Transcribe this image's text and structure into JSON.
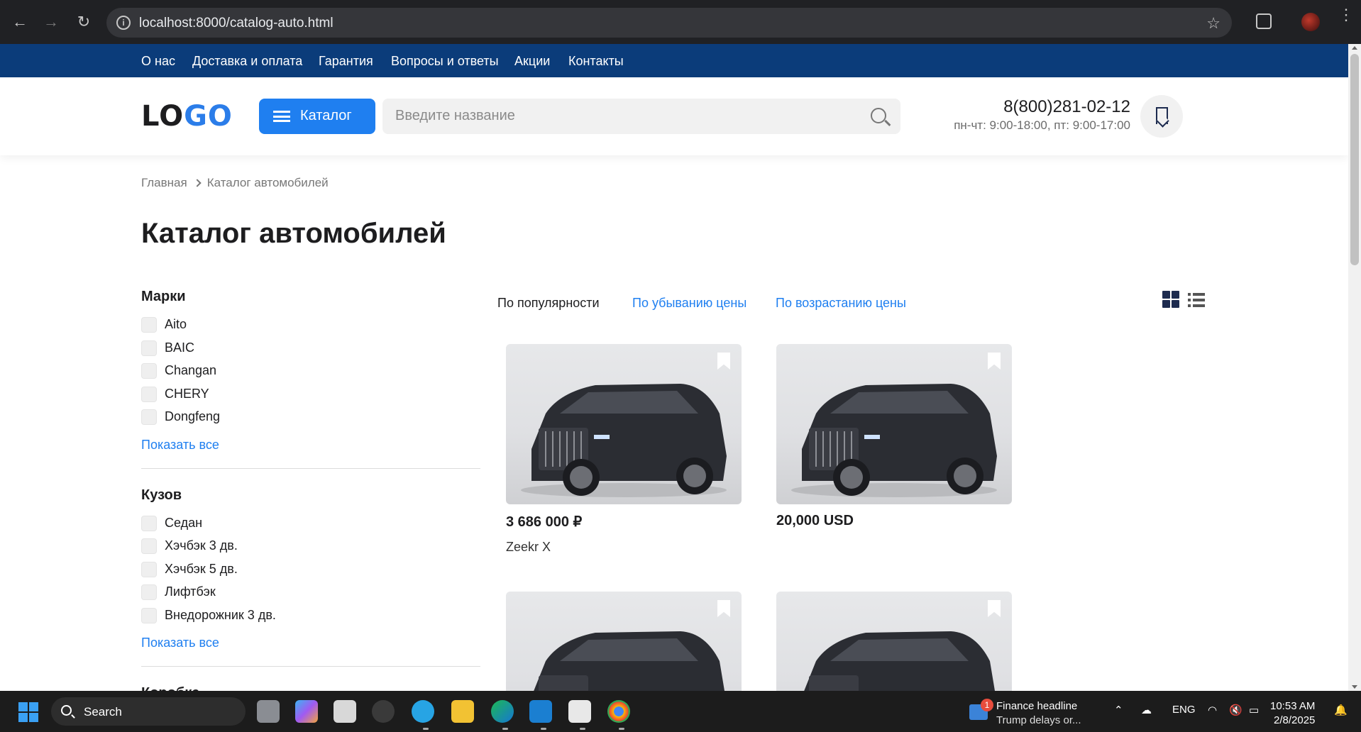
{
  "browser": {
    "url": "localhost:8000/catalog-auto.html"
  },
  "topnav": {
    "items": [
      "О нас",
      "Доставка и оплата",
      "Гарантия",
      "Вопросы и ответы",
      "Акции",
      "Контакты"
    ]
  },
  "header": {
    "logo_dark": "LO",
    "logo_blue": "GO",
    "catalog_label": "Каталог",
    "search_placeholder": "Введите название",
    "phone": "8(800)281-02-12",
    "hours": "пн-чт: 9:00-18:00, пт: 9:00-17:00"
  },
  "breadcrumb": {
    "home": "Главная",
    "current": "Каталог автомобилей"
  },
  "page_title": "Каталог автомобилей",
  "filters": {
    "brands": {
      "title": "Марки",
      "options": [
        "Aito",
        "BAIC",
        "Changan",
        "CHERY",
        "Dongfeng"
      ],
      "show_all": "Показать все"
    },
    "body": {
      "title": "Кузов",
      "options": [
        "Седан",
        "Хэчбэк 3 дв.",
        "Хэчбэк 5 дв.",
        "Лифтбэк",
        "Внедорожник 3 дв."
      ],
      "show_all": "Показать все"
    },
    "gearbox": {
      "title": "Коробка"
    }
  },
  "sort": {
    "popular": "По популярности",
    "price_desc": "По убыванию цены",
    "price_asc": "По возрастанию цены"
  },
  "products": [
    {
      "price": "3 686 000 ₽",
      "name": "Zeekr X"
    },
    {
      "price": "20,000 USD",
      "name": ""
    },
    {
      "price": "",
      "name": ""
    },
    {
      "price": "",
      "name": ""
    }
  ],
  "taskbar": {
    "search": "Search",
    "news_badge": "1",
    "news_headline": "Finance headline",
    "news_sub": "Trump delays or...",
    "lang": "ENG",
    "time": "10:53 AM",
    "date": "2/8/2025"
  },
  "colors": {
    "topbar": "#0b3c7a",
    "accent": "#1f7ff0"
  }
}
